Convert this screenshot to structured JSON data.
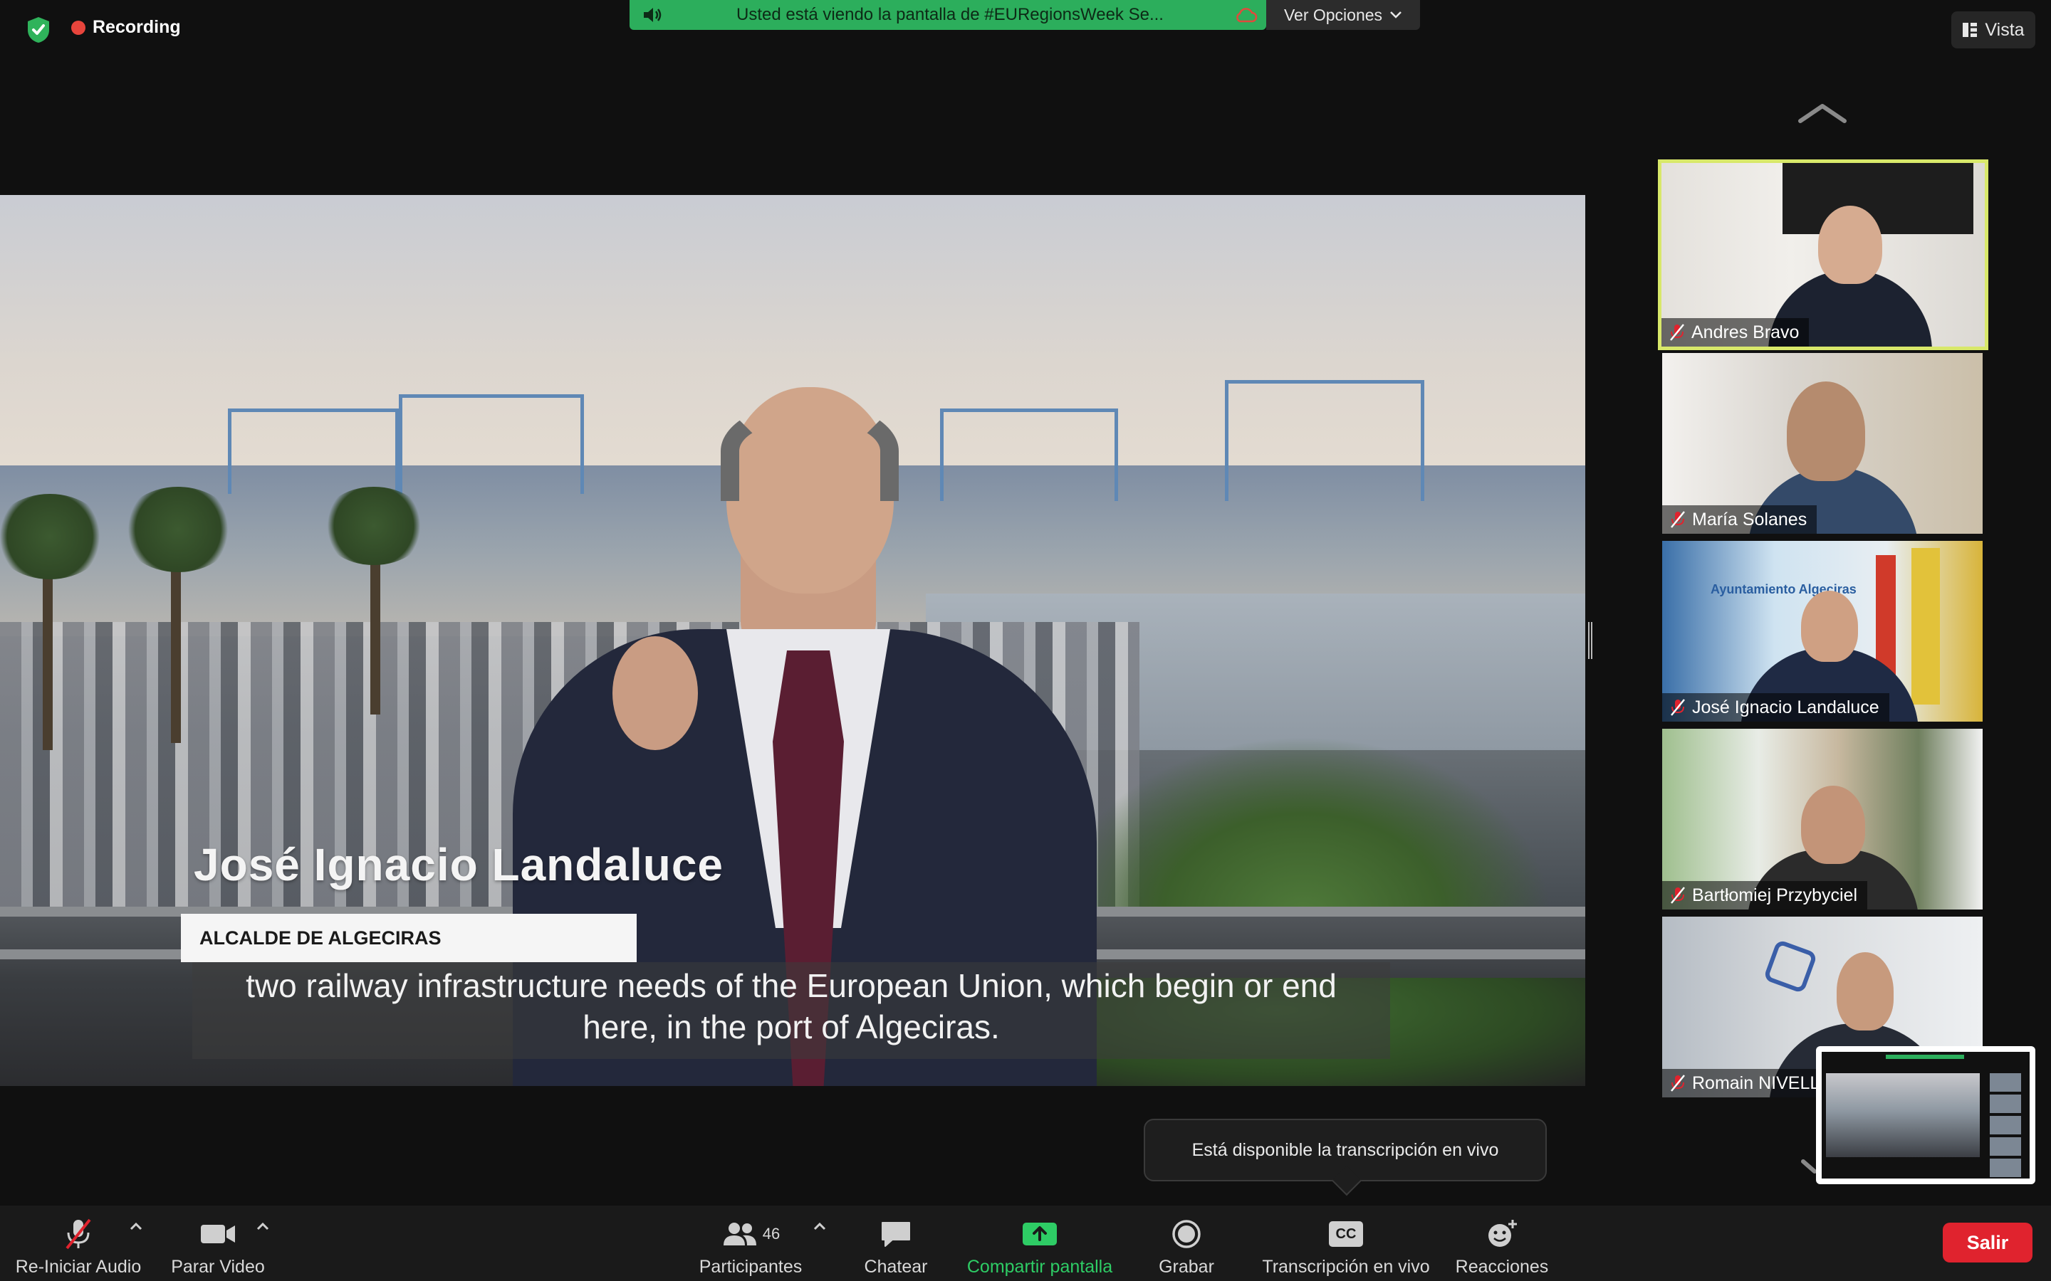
{
  "top_bar": {
    "recording_label": "Recording",
    "share_banner_text": "Usted está viendo la pantalla de #EURegionsWeek Se...",
    "view_options_label": "Ver Opciones",
    "view_button_label": "Vista"
  },
  "shared_screen": {
    "speaker_name_caption": "José Ignacio Landaluce",
    "speaker_role_caption": "ALCALDE DE ALGECIRAS",
    "subtitle_line1": "two railway infrastructure needs of the European Union, which begin or end",
    "subtitle_line2": "here, in the port of Algeciras."
  },
  "gallery": {
    "participants": [
      {
        "name": "Andres Bravo",
        "active_speaker": true,
        "muted": true
      },
      {
        "name": "María Solanes",
        "active_speaker": false,
        "muted": true
      },
      {
        "name": "José Ignacio Landaluce",
        "active_speaker": false,
        "muted": true
      },
      {
        "name": "Bartłomiej Przybyciel",
        "active_speaker": false,
        "muted": true
      },
      {
        "name": "Romain NIVELL",
        "active_speaker": false,
        "muted": true
      }
    ],
    "tile3_background_text": "Ayuntamiento   Algeciras"
  },
  "toast": {
    "text": "Está disponible la transcripción en vivo"
  },
  "toolbar": {
    "audio_label": "Re-Iniciar Audio",
    "video_label": "Parar Video",
    "participants_label": "Participantes",
    "participants_count": "46",
    "chat_label": "Chatear",
    "share_label": "Compartir pantalla",
    "record_label": "Grabar",
    "transcript_label": "Transcripción en vivo",
    "reactions_label": "Reacciones",
    "leave_label": "Salir",
    "cc_text": "CC"
  },
  "colors": {
    "share_green": "#2cae5c",
    "leave_red": "#e0232e",
    "active_speaker_border": "#d8e86a",
    "recording_dot": "#e8453c",
    "mute_icon_red": "#e0232e"
  },
  "icons": [
    "shield-check-icon",
    "recording-dot-icon",
    "speaker-icon",
    "cloud-icon",
    "chevron-down-icon",
    "grid-view-icon",
    "chevron-up-icon",
    "mic-off-icon",
    "video-camera-icon",
    "participants-icon",
    "chat-icon",
    "share-screen-icon",
    "record-icon",
    "cc-icon",
    "reaction-icon"
  ]
}
